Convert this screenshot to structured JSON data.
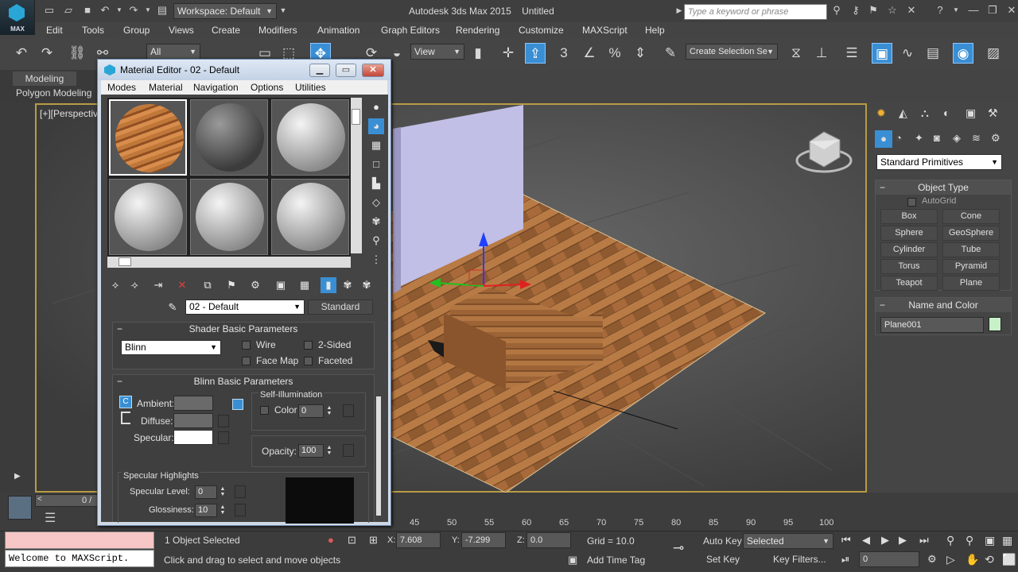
{
  "app": {
    "title": "Autodesk 3ds Max 2015",
    "file": "Untitled",
    "logo_text": "MAX",
    "workspace": "Workspace: Default",
    "search_placeholder": "Type a keyword or phrase"
  },
  "menus": [
    "Edit",
    "Tools",
    "Group",
    "Views",
    "Create",
    "Modifiers",
    "Animation",
    "Graph Editors",
    "Rendering",
    "Customize",
    "MAXScript",
    "Help"
  ],
  "toolbar": {
    "selection_filter": "All",
    "ref_coord": "View",
    "named_selection": "Create Selection Se",
    "snap_label": "3"
  },
  "ribbon": {
    "tab_active": "Modeling",
    "sub": "Polygon Modeling"
  },
  "viewport": {
    "label": "[+][Perspective]"
  },
  "material_editor": {
    "title": "Material Editor - 02 - Default",
    "menus": [
      "Modes",
      "Material",
      "Navigation",
      "Options",
      "Utilities"
    ],
    "material_name": "02 - Default",
    "material_type": "Standard",
    "shader_rollout": "Shader Basic Parameters",
    "shader": "Blinn",
    "shader_options": [
      "Wire",
      "2-Sided",
      "Face Map",
      "Faceted"
    ],
    "blinn_rollout": "Blinn Basic Parameters",
    "self_illum": {
      "label": "Self-Illumination",
      "color_label": "Color",
      "value": "0"
    },
    "ambient_label": "Ambient:",
    "diffuse_label": "Diffuse:",
    "specular_label": "Specular:",
    "lock_icon_text": "C",
    "opacity_label": "Opacity:",
    "opacity": "100",
    "spec_highlights": "Specular Highlights",
    "spec_level_label": "Specular Level:",
    "spec_level": "0",
    "glossiness_label": "Glossiness:",
    "glossiness": "10"
  },
  "command_panel": {
    "category": "Standard Primitives",
    "object_type": "Object Type",
    "autogrid": "AutoGrid",
    "buttons": [
      "Box",
      "Cone",
      "Sphere",
      "GeoSphere",
      "Cylinder",
      "Tube",
      "Torus",
      "Pyramid",
      "Teapot",
      "Plane"
    ],
    "name_and_color": "Name and Color",
    "object_name": "Plane001",
    "object_color": "#c8f0c8"
  },
  "timeline": {
    "frame": "0 /",
    "ruler": [
      "45",
      "50",
      "55",
      "60",
      "65",
      "70",
      "75",
      "80",
      "85",
      "90",
      "95",
      "100"
    ]
  },
  "status": {
    "selection": "1 Object Selected",
    "prompt": "Click and drag to select and move objects",
    "x_label": "X:",
    "x": "7.608",
    "y_label": "Y:",
    "y": "-7.299",
    "z_label": "Z:",
    "z": "0.0",
    "grid": "Grid = 10.0",
    "auto_key": "Auto Key",
    "set_key": "Set Key",
    "key_mode": "Selected",
    "key_filters": "Key Filters...",
    "add_time_tag": "Add Time Tag",
    "current_frame": "0",
    "maxscript_output": "Welcome to MAXScript."
  }
}
